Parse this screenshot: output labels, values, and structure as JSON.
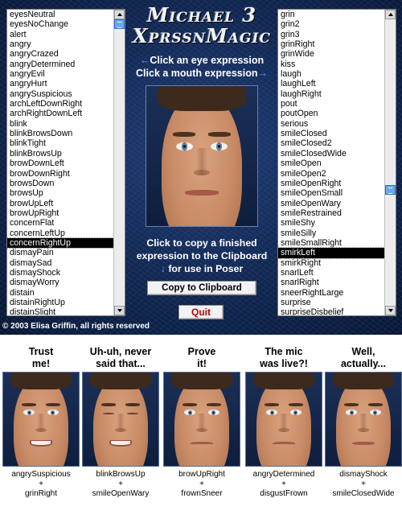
{
  "app": {
    "title_line1": "Michael 3",
    "title_line2": "XprssnMagic",
    "hint_eye_arrow": "←",
    "hint_eye": "Click an eye expression",
    "hint_mouth": "Click a mouth expression",
    "hint_mouth_arrow": "→",
    "copy_line1": "Click to copy a finished",
    "copy_line2": "expression to the Clipboard",
    "copy_arrow": "↓",
    "copy_line3": "for use in Poser",
    "copy_button": "Copy to Clipboard",
    "quit_button": "Quit",
    "copyright": "© 2003 Elisa Griffin, all rights reserved"
  },
  "eye_list": {
    "items": [
      "eyesNeutral",
      "eyesNoChange",
      "alert",
      "angry",
      "angryCrazed",
      "angryDetermined",
      "angryEvil",
      "angryHurt",
      "angrySuspicious",
      "archLeftDownRight",
      "archRightDownLeft",
      "blink",
      "blinkBrowsDown",
      "blinkTight",
      "blinkBrowsUp",
      "browDownLeft",
      "browDownRight",
      "browsDown",
      "browsUp",
      "browUpLeft",
      "browUpRight",
      "concernFlat",
      "concernLeftUp",
      "concernRightUp",
      "dismayPain",
      "dismaySad",
      "dismayShock",
      "dismayWorry",
      "distain",
      "distainRightUp",
      "distainSlight"
    ],
    "selected": "concernRightUp"
  },
  "mouth_list": {
    "items": [
      "grin",
      "grin2",
      "grin3",
      "grinRight",
      "grinWide",
      "kiss",
      "laugh",
      "laughLeft",
      "laughRight",
      "pout",
      "poutOpen",
      "serious",
      "smileClosed",
      "smileClosed2",
      "smileClosedWide",
      "smileOpen",
      "smileOpen2",
      "smileOpenRight",
      "smileOpenSmall",
      "smileOpenWary",
      "smileRestrained",
      "smileShy",
      "smileSilly",
      "smileSmallRight",
      "smirkLeft",
      "smirkRight",
      "snarlLeft",
      "snarlRight",
      "sneerRightLarge",
      "surprise",
      "surpriseDisbelief"
    ],
    "selected": "smirkLeft"
  },
  "examples": [
    {
      "caption_line1": "Trust",
      "caption_line2": "me!",
      "eye": "angrySuspicious",
      "plus": "+",
      "mouth": "grinRight",
      "mouth_style": "smile",
      "eye_style": "open"
    },
    {
      "caption_line1": "Uh-uh, never",
      "caption_line2": "said  that...",
      "eye": "blinkBrowsUp",
      "plus": "+",
      "mouth": "smileOpenWary",
      "mouth_style": "smile",
      "eye_style": "closed"
    },
    {
      "caption_line1": "Prove",
      "caption_line2": "it!",
      "eye": "browUpRight",
      "plus": "+",
      "mouth": "frownSneer",
      "mouth_style": "frown",
      "eye_style": "open"
    },
    {
      "caption_line1": "The mic",
      "caption_line2": "was live?!",
      "eye": "angryDetermined",
      "plus": "+",
      "mouth": "disgustFrown",
      "mouth_style": "frown",
      "eye_style": "open"
    },
    {
      "caption_line1": "Well,",
      "caption_line2": "actually...",
      "eye": "dismayShock",
      "plus": "+",
      "mouth": "smileClosedWide",
      "mouth_style": "flat",
      "eye_style": "open"
    }
  ],
  "colors": {
    "background": "#0b1c3a",
    "accent_arrow": "#5aa0ff",
    "quit_text": "#c00000",
    "selection": "#000000",
    "scroll_thumb": "#6aa8e8"
  },
  "scroll": {
    "left_thumb_fraction": 0.0,
    "right_thumb_fraction": 0.6
  }
}
